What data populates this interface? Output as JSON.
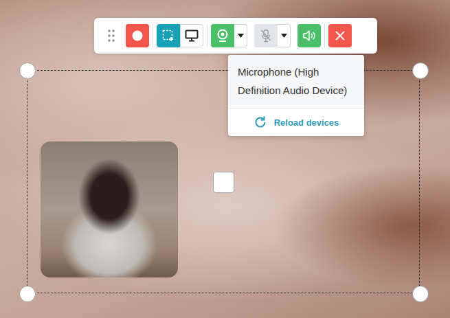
{
  "toolbar": {
    "capture_modes": [
      {
        "kind": "region",
        "selected": true
      },
      {
        "kind": "screen",
        "selected": false
      }
    ],
    "webcam": {
      "on": true
    },
    "microphone": {
      "on": false,
      "menu_open": true
    },
    "system_audio": {
      "on": true
    }
  },
  "microphone_menu": {
    "devices": [
      {
        "label": "Microphone (High Definition Audio Device)",
        "highlighted": true
      }
    ],
    "reload": "Reload devices"
  }
}
